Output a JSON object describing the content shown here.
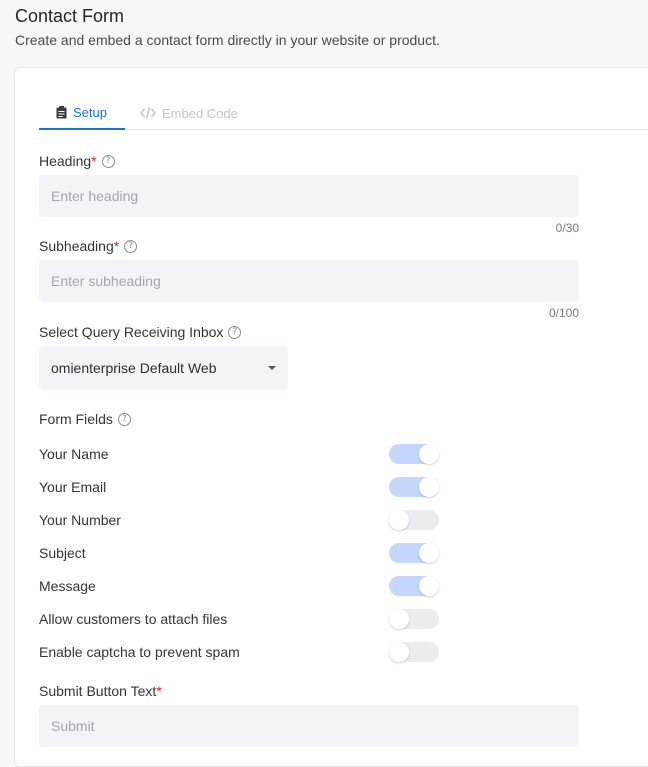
{
  "page": {
    "title": "Contact Form",
    "subtitle": "Create and embed a contact form directly in your website or product."
  },
  "tabs": [
    {
      "label": "Setup",
      "icon": "clipboard-icon",
      "active": true
    },
    {
      "label": "Embed Code",
      "icon": "code-icon",
      "active": false
    }
  ],
  "heading": {
    "label": "Heading",
    "required_mark": "*",
    "placeholder": "Enter heading",
    "value": "",
    "counter": "0/30"
  },
  "subheading": {
    "label": "Subheading",
    "required_mark": "*",
    "placeholder": "Enter subheading",
    "value": "",
    "counter": "0/100"
  },
  "inbox": {
    "label": "Select Query Receiving Inbox",
    "selected": "omienterprise Default Web"
  },
  "form_fields": {
    "label": "Form Fields",
    "items": [
      {
        "label": "Your Name",
        "enabled": true
      },
      {
        "label": "Your Email",
        "enabled": true
      },
      {
        "label": "Your Number",
        "enabled": false
      },
      {
        "label": "Subject",
        "enabled": true
      },
      {
        "label": "Message",
        "enabled": true
      },
      {
        "label": "Allow customers to attach files",
        "enabled": false
      },
      {
        "label": "Enable captcha to prevent spam",
        "enabled": false
      }
    ]
  },
  "submit": {
    "label": "Submit Button Text",
    "required_mark": "*",
    "placeholder": "Submit",
    "value": ""
  },
  "colors": {
    "accent": "#1f6fd8",
    "toggle_on": "#c4d8fd",
    "toggle_off": "#ececef",
    "required": "#e02424"
  }
}
